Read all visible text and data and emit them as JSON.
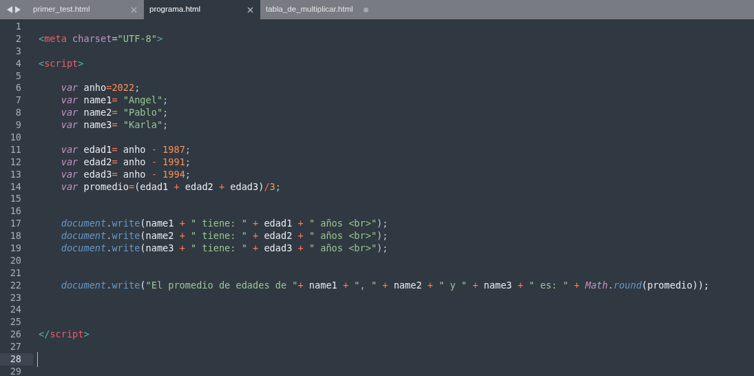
{
  "tabs": [
    {
      "label": "primer_test.html",
      "selected": false,
      "modified": false
    },
    {
      "label": "programa.html",
      "selected": true,
      "modified": false
    },
    {
      "label": "tabla_de_multiplicar.html",
      "selected": false,
      "modified": true
    }
  ],
  "editor": {
    "lines": [
      {
        "number": "1",
        "current": false
      },
      {
        "number": "2",
        "current": false,
        "tokens": [
          {
            "text": "<",
            "kind": "bracket"
          },
          {
            "text": "meta",
            "kind": "tag"
          },
          {
            "text": " charset",
            "kind": "attr"
          },
          {
            "text": "=",
            "kind": "plain"
          },
          {
            "text": "\"UTF-8\"",
            "kind": "string"
          },
          {
            "text": ">",
            "kind": "bracket"
          }
        ]
      },
      {
        "number": "3",
        "current": false
      },
      {
        "number": "4",
        "current": false,
        "tokens": [
          {
            "text": "<",
            "kind": "bracket"
          },
          {
            "text": "script",
            "kind": "tag"
          },
          {
            "text": ">",
            "kind": "bracket"
          }
        ]
      },
      {
        "number": "5",
        "current": false
      },
      {
        "number": "6",
        "current": false,
        "tokens": [
          {
            "text": "    var",
            "kind": "keyword"
          },
          {
            "text": " anho",
            "kind": "ident"
          },
          {
            "text": "=",
            "kind": "operator"
          },
          {
            "text": "2022",
            "kind": "number"
          },
          {
            "text": ";",
            "kind": "plain"
          }
        ]
      },
      {
        "number": "7",
        "current": false,
        "tokens": [
          {
            "text": "    var",
            "kind": "keyword"
          },
          {
            "text": " name1",
            "kind": "ident"
          },
          {
            "text": "=",
            "kind": "operator"
          },
          {
            "text": " \"Angel\"",
            "kind": "string"
          },
          {
            "text": ";",
            "kind": "plain"
          }
        ]
      },
      {
        "number": "8",
        "current": false,
        "tokens": [
          {
            "text": "    var",
            "kind": "keyword"
          },
          {
            "text": " name2",
            "kind": "ident"
          },
          {
            "text": "=",
            "kind": "operator"
          },
          {
            "text": " \"Pablo\"",
            "kind": "string"
          },
          {
            "text": ";",
            "kind": "plain"
          }
        ]
      },
      {
        "number": "9",
        "current": false,
        "tokens": [
          {
            "text": "    var",
            "kind": "keyword"
          },
          {
            "text": " name3",
            "kind": "ident"
          },
          {
            "text": "=",
            "kind": "operator"
          },
          {
            "text": " \"Karla\"",
            "kind": "string"
          },
          {
            "text": ";",
            "kind": "plain"
          }
        ]
      },
      {
        "number": "10",
        "current": false
      },
      {
        "number": "11",
        "current": false,
        "tokens": [
          {
            "text": "    var",
            "kind": "keyword"
          },
          {
            "text": " edad1",
            "kind": "ident"
          },
          {
            "text": "=",
            "kind": "operator"
          },
          {
            "text": " anho ",
            "kind": "ident"
          },
          {
            "text": "-",
            "kind": "operator"
          },
          {
            "text": " 1987",
            "kind": "number"
          },
          {
            "text": ";",
            "kind": "plain"
          }
        ]
      },
      {
        "number": "12",
        "current": false,
        "tokens": [
          {
            "text": "    var",
            "kind": "keyword"
          },
          {
            "text": " edad2",
            "kind": "ident"
          },
          {
            "text": "=",
            "kind": "operator"
          },
          {
            "text": " anho ",
            "kind": "ident"
          },
          {
            "text": "-",
            "kind": "operator"
          },
          {
            "text": " 1991",
            "kind": "number"
          },
          {
            "text": ";",
            "kind": "plain"
          }
        ]
      },
      {
        "number": "13",
        "current": false,
        "tokens": [
          {
            "text": "    var",
            "kind": "keyword"
          },
          {
            "text": " edad3",
            "kind": "ident"
          },
          {
            "text": "=",
            "kind": "operator"
          },
          {
            "text": " anho ",
            "kind": "ident"
          },
          {
            "text": "-",
            "kind": "operator"
          },
          {
            "text": " 1994",
            "kind": "number"
          },
          {
            "text": ";",
            "kind": "plain"
          }
        ]
      },
      {
        "number": "14",
        "current": false,
        "tokens": [
          {
            "text": "    var",
            "kind": "keyword"
          },
          {
            "text": " promedio",
            "kind": "ident"
          },
          {
            "text": "=",
            "kind": "operator"
          },
          {
            "text": "(edad1 ",
            "kind": "ident"
          },
          {
            "text": "+",
            "kind": "operator"
          },
          {
            "text": " edad2 ",
            "kind": "ident"
          },
          {
            "text": "+",
            "kind": "operator"
          },
          {
            "text": " edad3)",
            "kind": "ident"
          },
          {
            "text": "/",
            "kind": "operator"
          },
          {
            "text": "3",
            "kind": "number"
          },
          {
            "text": ";",
            "kind": "plain"
          }
        ]
      },
      {
        "number": "15",
        "current": false
      },
      {
        "number": "16",
        "current": false
      },
      {
        "number": "17",
        "current": false,
        "tokens": [
          {
            "text": "    document",
            "kind": "builtin"
          },
          {
            "text": ".",
            "kind": "plain"
          },
          {
            "text": "write",
            "kind": "method"
          },
          {
            "text": "(name1 ",
            "kind": "ident"
          },
          {
            "text": "+",
            "kind": "operator"
          },
          {
            "text": " \" tiene: \" ",
            "kind": "string"
          },
          {
            "text": "+",
            "kind": "operator"
          },
          {
            "text": " edad1 ",
            "kind": "ident"
          },
          {
            "text": "+",
            "kind": "operator"
          },
          {
            "text": " \" años <br>\"",
            "kind": "string"
          },
          {
            "text": ");",
            "kind": "plain"
          }
        ]
      },
      {
        "number": "18",
        "current": false,
        "tokens": [
          {
            "text": "    document",
            "kind": "builtin"
          },
          {
            "text": ".",
            "kind": "plain"
          },
          {
            "text": "write",
            "kind": "method"
          },
          {
            "text": "(name2 ",
            "kind": "ident"
          },
          {
            "text": "+",
            "kind": "operator"
          },
          {
            "text": " \" tiene: \" ",
            "kind": "string"
          },
          {
            "text": "+",
            "kind": "operator"
          },
          {
            "text": " edad2 ",
            "kind": "ident"
          },
          {
            "text": "+",
            "kind": "operator"
          },
          {
            "text": " \" años <br>\"",
            "kind": "string"
          },
          {
            "text": ");",
            "kind": "plain"
          }
        ]
      },
      {
        "number": "19",
        "current": false,
        "tokens": [
          {
            "text": "    document",
            "kind": "builtin"
          },
          {
            "text": ".",
            "kind": "plain"
          },
          {
            "text": "write",
            "kind": "method"
          },
          {
            "text": "(name3 ",
            "kind": "ident"
          },
          {
            "text": "+",
            "kind": "operator"
          },
          {
            "text": " \" tiene: \" ",
            "kind": "string"
          },
          {
            "text": "+",
            "kind": "operator"
          },
          {
            "text": " edad3 ",
            "kind": "ident"
          },
          {
            "text": "+",
            "kind": "operator"
          },
          {
            "text": " \" años <br>\"",
            "kind": "string"
          },
          {
            "text": ");",
            "kind": "plain"
          }
        ]
      },
      {
        "number": "20",
        "current": false
      },
      {
        "number": "21",
        "current": false
      },
      {
        "number": "22",
        "current": false,
        "tokens": [
          {
            "text": "    document",
            "kind": "builtin"
          },
          {
            "text": ".",
            "kind": "plain"
          },
          {
            "text": "write",
            "kind": "method"
          },
          {
            "text": "(",
            "kind": "ident"
          },
          {
            "text": "\"El promedio de edades de \"",
            "kind": "string"
          },
          {
            "text": "+",
            "kind": "operator"
          },
          {
            "text": " name1 ",
            "kind": "ident"
          },
          {
            "text": "+",
            "kind": "operator"
          },
          {
            "text": " \", \" ",
            "kind": "string"
          },
          {
            "text": "+",
            "kind": "operator"
          },
          {
            "text": " name2 ",
            "kind": "ident"
          },
          {
            "text": "+",
            "kind": "operator"
          },
          {
            "text": " \" y \" ",
            "kind": "string"
          },
          {
            "text": "+",
            "kind": "operator"
          },
          {
            "text": " name3 ",
            "kind": "ident"
          },
          {
            "text": "+",
            "kind": "operator"
          },
          {
            "text": " \" es: \" ",
            "kind": "string"
          },
          {
            "text": "+",
            "kind": "operator"
          },
          {
            "text": " Math",
            "kind": "class"
          },
          {
            "text": ".",
            "kind": "plain"
          },
          {
            "text": "round",
            "kind": "builtin"
          },
          {
            "text": "(promedio));",
            "kind": "ident"
          }
        ]
      },
      {
        "number": "23",
        "current": false
      },
      {
        "number": "24",
        "current": false
      },
      {
        "number": "25",
        "current": false
      },
      {
        "number": "26",
        "current": false,
        "tokens": [
          {
            "text": "</",
            "kind": "bracket"
          },
          {
            "text": "script",
            "kind": "tag"
          },
          {
            "text": ">",
            "kind": "bracket"
          }
        ]
      },
      {
        "number": "27",
        "current": false
      },
      {
        "number": "28",
        "current": true
      },
      {
        "number": "29",
        "current": false
      }
    ]
  }
}
